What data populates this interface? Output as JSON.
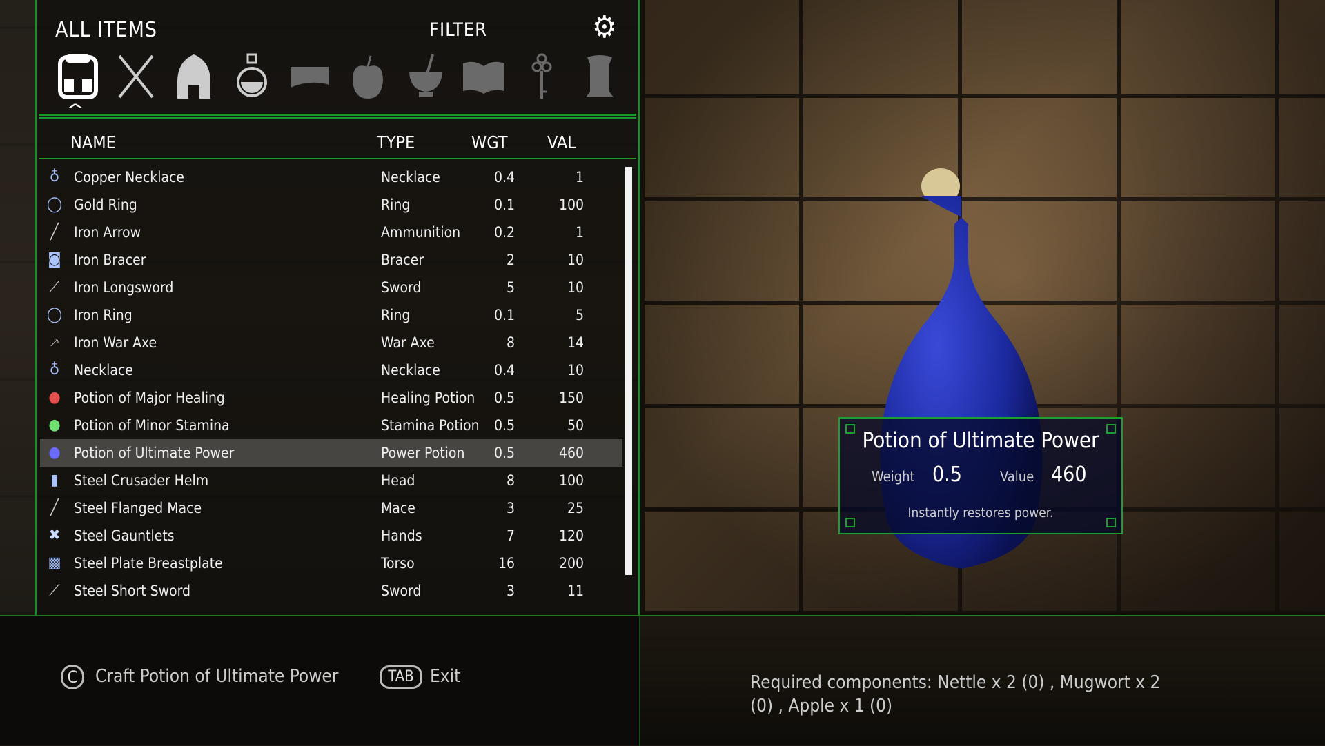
{
  "header": {
    "title": "ALL ITEMS",
    "filter_label": "FILTER",
    "settings_icon": "gear-icon"
  },
  "categories": [
    {
      "name": "all-items",
      "icon": "backpack-icon",
      "active": true
    },
    {
      "name": "weapons",
      "icon": "crossed-swords-icon"
    },
    {
      "name": "apparel",
      "icon": "helmet-icon"
    },
    {
      "name": "potions",
      "icon": "potion-icon"
    },
    {
      "name": "scrolls",
      "icon": "scroll-icon"
    },
    {
      "name": "food",
      "icon": "apple-icon"
    },
    {
      "name": "ingredients",
      "icon": "mortar-pestle-icon"
    },
    {
      "name": "books",
      "icon": "book-icon"
    },
    {
      "name": "keys",
      "icon": "key-icon"
    },
    {
      "name": "misc",
      "icon": "misc-icon"
    }
  ],
  "columns": {
    "name": "NAME",
    "type": "TYPE",
    "weight": "WGT",
    "value": "VAL"
  },
  "items": [
    {
      "icon": "necklace-icon",
      "name": "Copper Necklace",
      "type": "Necklace",
      "weight": "0.4",
      "value": "1"
    },
    {
      "icon": "ring-icon",
      "name": "Gold Ring",
      "type": "Ring",
      "weight": "0.1",
      "value": "100"
    },
    {
      "icon": "arrow-icon",
      "name": "Iron Arrow",
      "type": "Ammunition",
      "weight": "0.2",
      "value": "1"
    },
    {
      "icon": "bracer-icon",
      "name": "Iron Bracer",
      "type": "Bracer",
      "weight": "2",
      "value": "10"
    },
    {
      "icon": "sword-icon",
      "name": "Iron Longsword",
      "type": "Sword",
      "weight": "5",
      "value": "10"
    },
    {
      "icon": "ring-icon",
      "name": "Iron Ring",
      "type": "Ring",
      "weight": "0.1",
      "value": "5"
    },
    {
      "icon": "axe-icon",
      "name": "Iron War Axe",
      "type": "War Axe",
      "weight": "8",
      "value": "14"
    },
    {
      "icon": "necklace-icon",
      "name": "Necklace",
      "type": "Necklace",
      "weight": "0.4",
      "value": "10"
    },
    {
      "icon": "red-potion-icon",
      "name": "Potion of Major Healing",
      "type": "Healing Potion",
      "weight": "0.5",
      "value": "150"
    },
    {
      "icon": "green-potion-icon",
      "name": "Potion of Minor Stamina",
      "type": "Stamina Potion",
      "weight": "0.5",
      "value": "50"
    },
    {
      "icon": "blue-potion-icon",
      "name": "Potion of Ultimate Power",
      "type": "Power Potion",
      "weight": "0.5",
      "value": "460",
      "selected": true
    },
    {
      "icon": "helm-icon",
      "name": "Steel Crusader Helm",
      "type": "Head",
      "weight": "8",
      "value": "100"
    },
    {
      "icon": "mace-icon",
      "name": "Steel Flanged Mace",
      "type": "Mace",
      "weight": "3",
      "value": "25"
    },
    {
      "icon": "gauntlets-icon",
      "name": "Steel Gauntlets",
      "type": "Hands",
      "weight": "7",
      "value": "120"
    },
    {
      "icon": "breastplate-icon",
      "name": "Steel Plate Breastplate",
      "type": "Torso",
      "weight": "16",
      "value": "200"
    },
    {
      "icon": "sword-icon",
      "name": "Steel Short Sword",
      "type": "Sword",
      "weight": "3",
      "value": "11"
    }
  ],
  "tooltip": {
    "title": "Potion of Ultimate Power",
    "weight_label": "Weight",
    "weight": "0.5",
    "value_label": "Value",
    "value": "460",
    "description": "Instantly restores power."
  },
  "actions": {
    "craft_key": "C",
    "craft_label": "Craft Potion of Ultimate Power",
    "exit_key": "TAB",
    "exit_label": "Exit"
  },
  "requirements": {
    "line1": "Required components:  Nettle x 2 (0) , Mugwort x 2",
    "line2": "(0) , Apple x 1 (0)"
  },
  "colors": {
    "accent": "#1a9a2a",
    "selected_row": "#5a5650",
    "potion_blue": "#1c2aa0"
  }
}
